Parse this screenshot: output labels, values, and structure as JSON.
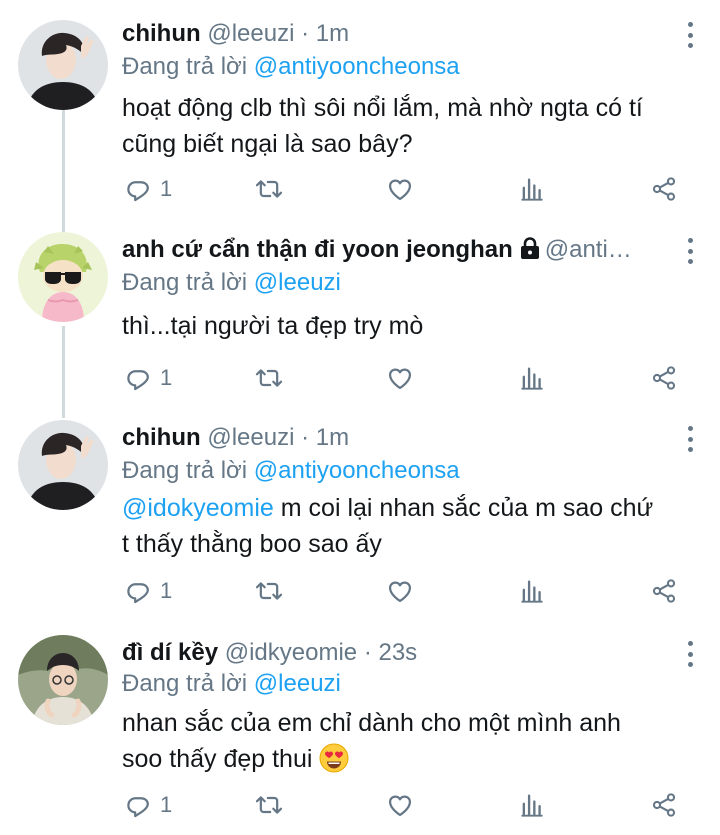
{
  "tweets": [
    {
      "name": "chihun",
      "handle": "@leeuzi",
      "time": "1m",
      "reply_prefix": "Đang trả lời",
      "reply_to": "@antiyooncheonsa",
      "text_line1": "hoạt động clb thì sôi nổi lắm, mà nhờ ngta có tí",
      "text_line2": "cũng biết ngại là sao bây?",
      "reply_count": "1",
      "avatar": "avatar-chihun"
    },
    {
      "name": "anh cứ cẩn thận đi yoon jeonghan",
      "handle": "@anti…",
      "time": "",
      "locked": true,
      "reply_prefix": "Đang trả lời",
      "reply_to": "@leeuzi",
      "text_line1": "thì...tại người ta đẹp try mò",
      "reply_count": "1",
      "avatar": "avatar-cartoon-sunglasses"
    },
    {
      "name": "chihun",
      "handle": "@leeuzi",
      "time": "1m",
      "reply_prefix": "Đang trả lời",
      "reply_to": "@antiyooncheonsa",
      "text_mention": "@idokyeomie",
      "text_line1": " m coi lại nhan sắc của m sao chứ",
      "text_line2": "t thấy thằng boo sao ấy",
      "reply_count": "1",
      "avatar": "avatar-chihun"
    },
    {
      "name": "đì dí kềy",
      "handle": "@idkyeomie",
      "time": "23s",
      "reply_prefix": "Đang trả lời",
      "reply_to": "@leeuzi",
      "text_line1": "nhan sắc của em chỉ dành cho một mình anh",
      "text_line2": "soo thấy đẹp thui",
      "emoji": "heart-eyes-emoji",
      "reply_count": "1",
      "avatar": "avatar-idkyeomie"
    }
  ],
  "separator": "·",
  "icons": [
    "reply-icon",
    "retweet-icon",
    "like-icon",
    "analytics-icon",
    "share-icon",
    "more-icon",
    "lock-icon"
  ],
  "colors": {
    "link": "#1da1f2",
    "secondary": "#657786",
    "text": "#14171a",
    "thread": "#cfd9de"
  }
}
